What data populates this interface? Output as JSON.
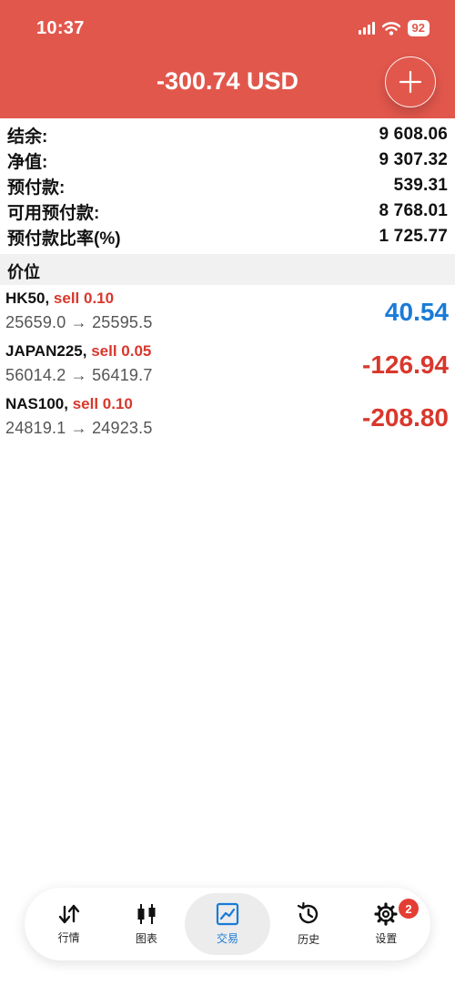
{
  "status_bar": {
    "time": "10:37",
    "battery": "92"
  },
  "header": {
    "title": "-300.74 USD"
  },
  "summary": [
    {
      "label": "结余:",
      "value": "9 608.06"
    },
    {
      "label": "净值:",
      "value": "9 307.32"
    },
    {
      "label": "预付款:",
      "value": "539.31"
    },
    {
      "label": "可用预付款:",
      "value": "8 768.01"
    },
    {
      "label": "预付款比率(%)",
      "value": "1 725.77"
    }
  ],
  "section": {
    "title": "价位"
  },
  "positions": [
    {
      "symbol": "HK50,",
      "side": "sell 0.10",
      "prices": "25659.0 → 25595.5",
      "profit": "40.54",
      "profit_color": "#1a7bd8"
    },
    {
      "symbol": "JAPAN225,",
      "side": "sell 0.05",
      "prices": "56014.2 → 56419.7",
      "profit": "-126.94",
      "profit_color": "#d9372c"
    },
    {
      "symbol": "NAS100,",
      "side": "sell 0.10",
      "prices": "24819.1 → 24923.5",
      "profit": "-208.80",
      "profit_color": "#d9372c"
    }
  ],
  "tabbar": {
    "tabs": [
      {
        "label": "行情",
        "icon": "arrows-up-down-icon"
      },
      {
        "label": "图表",
        "icon": "candlestick-icon"
      },
      {
        "label": "交易",
        "icon": "trade-chart-icon",
        "active": true
      },
      {
        "label": "历史",
        "icon": "history-icon"
      },
      {
        "label": "设置",
        "icon": "gear-icon",
        "badge": "2"
      }
    ]
  },
  "colors": {
    "header": "#e2574c",
    "sell": "#d9372c",
    "profit_positive": "#1a7bd8",
    "profit_negative": "#d9372c",
    "active_tab": "#1a7bd8"
  }
}
